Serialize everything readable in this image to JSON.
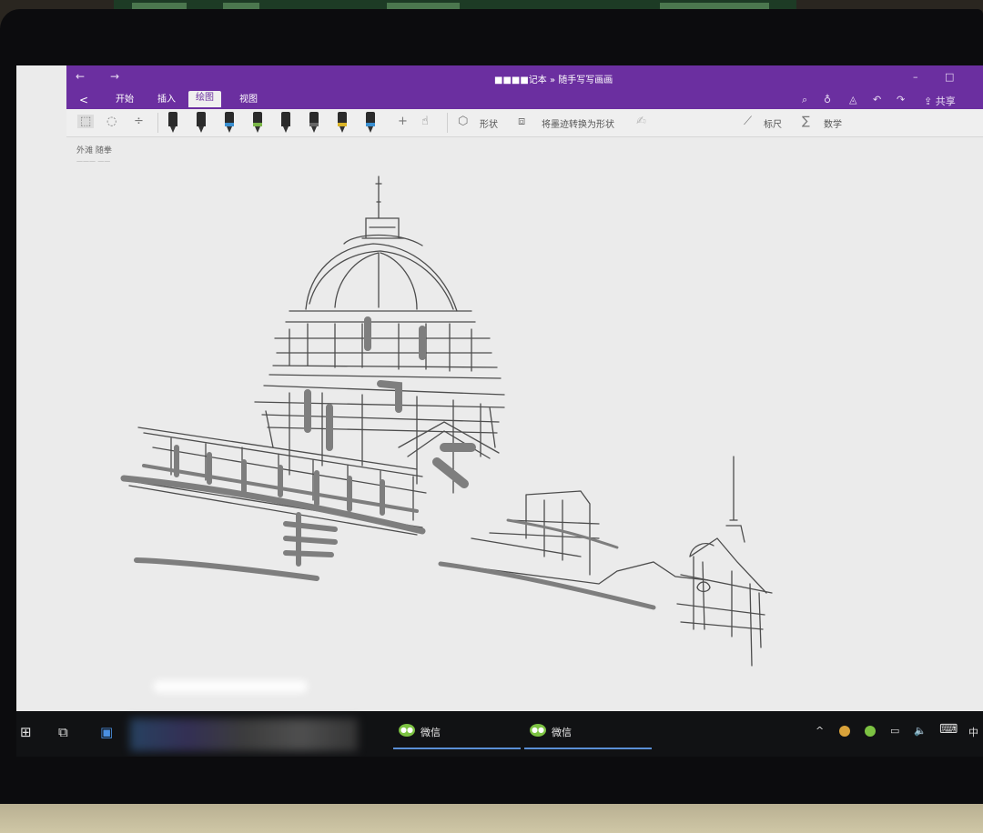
{
  "title_bar": {
    "back": "←",
    "forward": "→",
    "document_title": "■■■■记本 » 随手写写画画",
    "minimize": "–",
    "maximize": "□"
  },
  "ribbon": {
    "back": "<",
    "tabs": [
      {
        "label": "开始",
        "active": false
      },
      {
        "label": "插入",
        "active": false
      },
      {
        "label": "绘图",
        "active": true
      },
      {
        "label": "视图",
        "active": false
      }
    ],
    "share": "共享"
  },
  "toolbar": {
    "shapes": "形状",
    "ink_to_shape": "将墨迹转换为形状",
    "ruler": "标尺",
    "math": "数学",
    "add": "+",
    "pens": [
      {
        "band": "#2b2b2b"
      },
      {
        "band": "#2b2b2b"
      },
      {
        "band": "#3a8fd0"
      },
      {
        "band": "#7ab648"
      },
      {
        "band": "#2b2b2b"
      },
      {
        "band": "#666666"
      },
      {
        "band": "#d9b326"
      },
      {
        "band": "#3a8fd0"
      }
    ]
  },
  "page": {
    "title": "外滩 随拳",
    "subtitle": "———  ——"
  },
  "taskbar": {
    "windows_icon": "⊞",
    "task_view_icon": "⧉",
    "apps": [
      {
        "label": "微信"
      },
      {
        "label": "微信"
      }
    ],
    "tray_up": "^",
    "volume": "🔈",
    "keyboard": "⌨",
    "ime": "中"
  },
  "colors": {
    "accent_purple": "#6b2fa0",
    "sketch_stroke": "#4a4a4a",
    "taskbar": "#111214",
    "wechat_green": "#7cc242"
  }
}
